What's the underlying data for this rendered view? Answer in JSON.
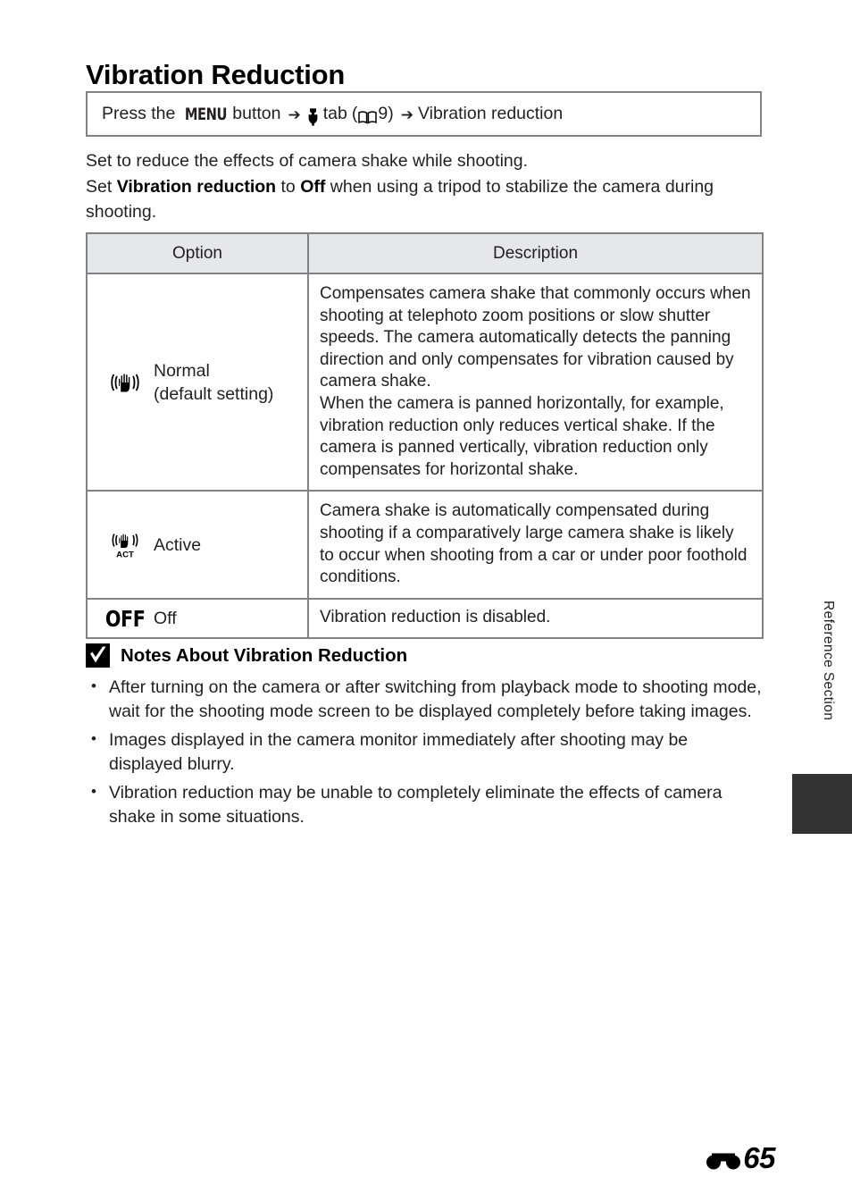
{
  "document": {
    "title": "Vibration Reduction"
  },
  "nav": {
    "press_the": "Press the",
    "menu_label": "MENU",
    "button_word": "button",
    "arrow": "➔",
    "setup_tab_icon": "wrench-icon",
    "tab_word": "tab",
    "ref_open": "(",
    "book_icon": "book-icon",
    "ref_page": "9",
    "ref_close": ")",
    "destination": "Vibration reduction"
  },
  "intro": {
    "line1": "Set to reduce the effects of camera shake while shooting.",
    "line2_a": "Set ",
    "line2_bold1": "Vibration reduction",
    "line2_b": " to ",
    "line2_bold2": "Off",
    "line2_c": " when using a tripod to stabilize the camera during shooting."
  },
  "table": {
    "headers": {
      "option": "Option",
      "description": "Description"
    },
    "rows": [
      {
        "icon": "vibration-reduction-normal-icon",
        "label_line1": "Normal",
        "label_line2": "(default setting)",
        "description": "Compensates camera shake that commonly occurs when shooting at telephoto zoom positions or slow shutter speeds. The camera automatically detects the panning direction and only compensates for vibration caused by camera shake.\nWhen the camera is panned horizontally, for example, vibration reduction only reduces vertical shake. If the camera is panned vertically, vibration reduction only compensates for horizontal shake."
      },
      {
        "icon": "vibration-reduction-active-icon",
        "label_line1": "Active",
        "label_line2": "",
        "description": "Camera shake is automatically compensated during shooting if a comparatively large camera shake is likely to occur when shooting from a car or under poor foothold conditions."
      },
      {
        "icon": "vibration-reduction-off-icon",
        "icon_text": "OFF",
        "label_line1": "Off",
        "label_line2": "",
        "description": "Vibration reduction is disabled."
      }
    ]
  },
  "notes": {
    "badge_icon": "checkmark-icon",
    "title": "Notes About Vibration Reduction",
    "items": [
      "After turning on the camera or after switching from playback mode to shooting mode, wait for the shooting mode screen to be displayed completely before taking images.",
      "Images displayed in the camera monitor immediately after shooting may be displayed blurry.",
      "Vibration reduction may be unable to completely eliminate the effects of camera shake in some situations."
    ]
  },
  "side_tab": {
    "label": "Reference Section"
  },
  "footer": {
    "symbol_icon": "reference-section-symbol",
    "page_number": "65"
  },
  "colors": {
    "text": "#231f20",
    "rule": "#808285",
    "header_fill": "#e6e7e8",
    "tab_block": "#333333"
  }
}
